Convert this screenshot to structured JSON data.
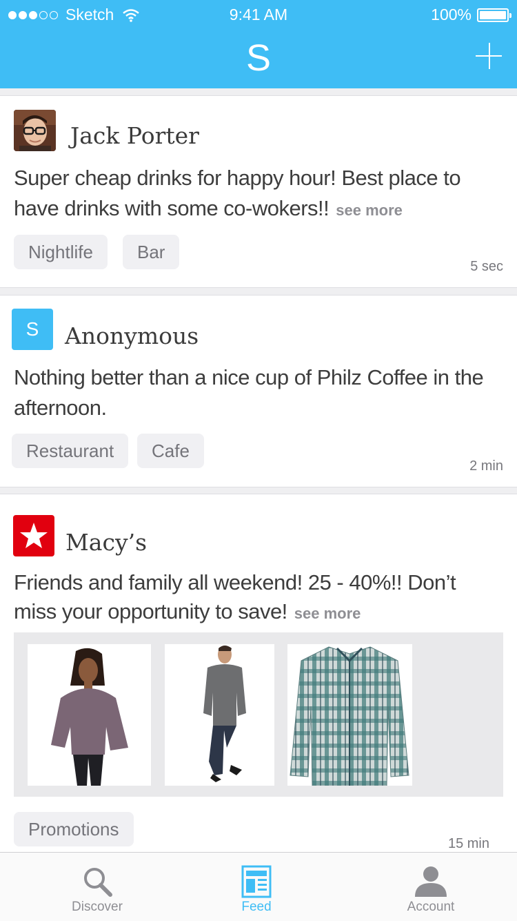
{
  "status_bar": {
    "carrier": "Sketch",
    "time": "9:41 AM",
    "battery": "100%"
  },
  "header": {
    "logo": "S",
    "add_icon": "plus-icon"
  },
  "posts": [
    {
      "author": "Jack Porter",
      "text": "Super cheap drinks for happy hour! Best place to have drinks with some co-wokers!!",
      "see_more": "see more",
      "tags": [
        "Nightlife",
        "Bar"
      ],
      "time": "5 sec"
    },
    {
      "author": "Anonymous",
      "avatar_letter": "S",
      "text": "Nothing better than a nice cup of Philz Coffee in the afternoon.",
      "tags": [
        "Restaurant",
        "Cafe"
      ],
      "time": "2 min"
    },
    {
      "author": "Macy’s",
      "avatar_icon": "star-icon",
      "text": "Friends and family all weekend! 25 - 40%!! Don’t miss your opportunity to save!",
      "see_more": "see more",
      "tags": [
        "Promotions"
      ],
      "time": "15 min"
    }
  ],
  "tabbar": {
    "items": [
      {
        "label": "Discover",
        "icon": "search-icon"
      },
      {
        "label": "Feed",
        "icon": "feed-icon",
        "active": true
      },
      {
        "label": "Account",
        "icon": "person-icon"
      }
    ]
  },
  "colors": {
    "accent": "#3fbdf5",
    "macys_red": "#e1000f"
  }
}
